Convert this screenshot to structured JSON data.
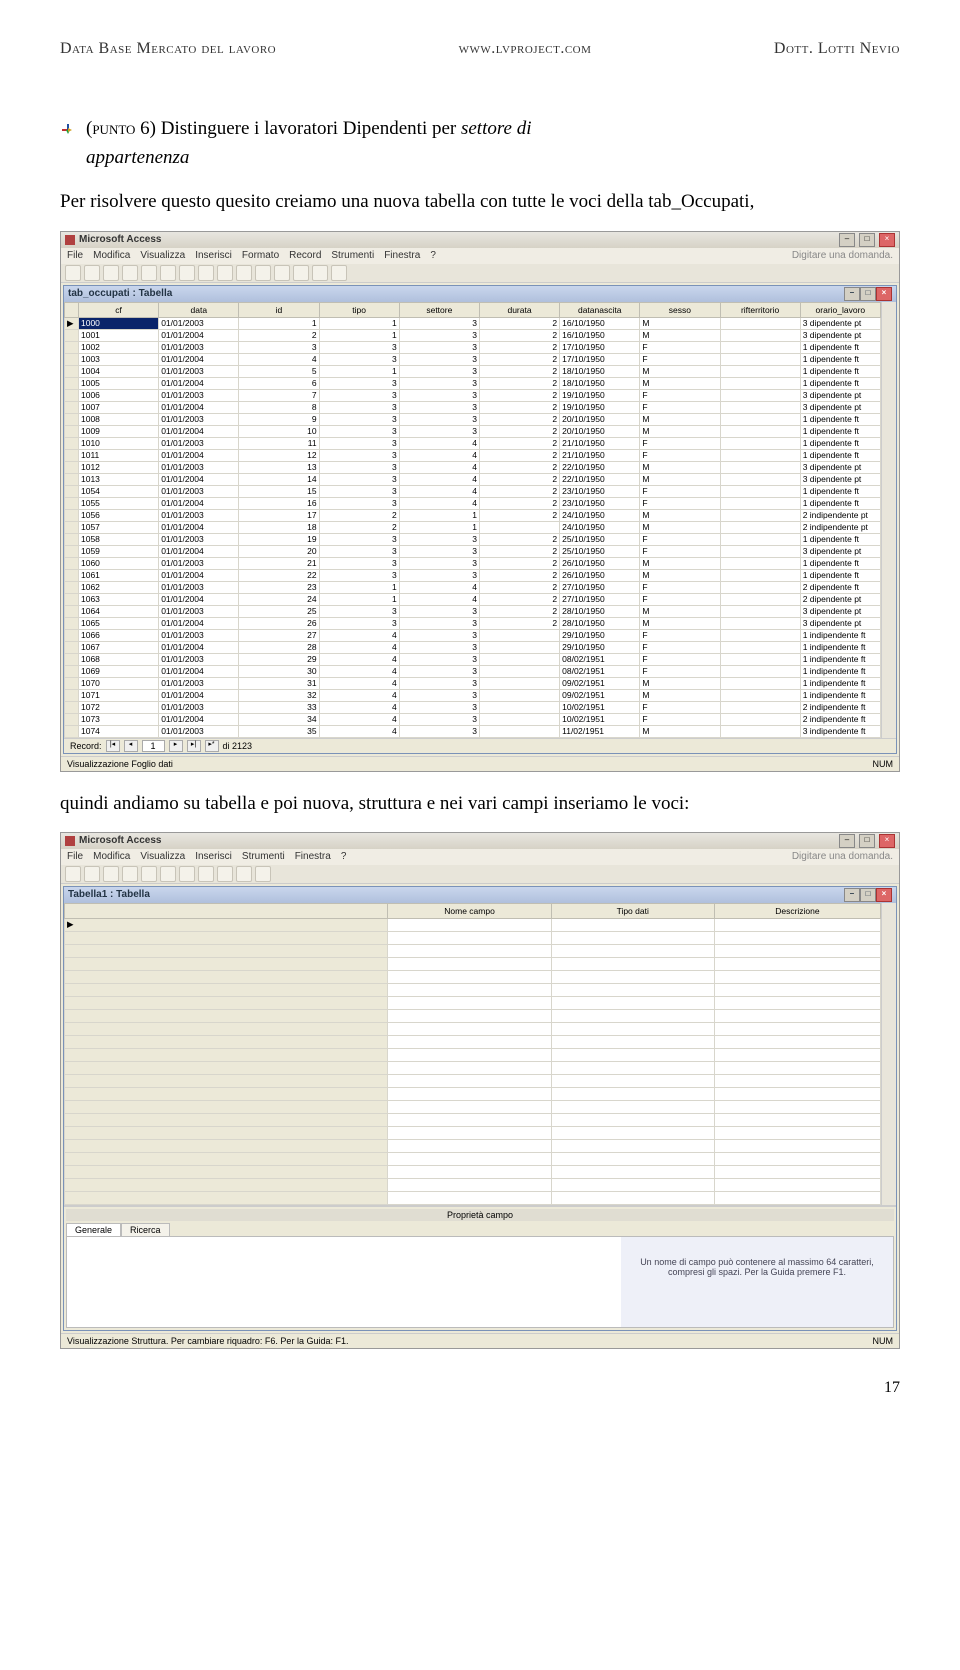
{
  "header": {
    "left": "Data Base Mercato del lavoro",
    "center": "www.lvproject.com",
    "right": "Dott. Lotti Nevio"
  },
  "intro": {
    "punto_label": "(punto 6)",
    "line1_a": " Distinguere i lavoratori Dipendenti per ",
    "line1_b": "settore di",
    "line2": "appartenenza"
  },
  "para1": "Per risolvere questo quesito creiamo una nuova tabella con tutte le voci della tab_Occupati,",
  "shot1": {
    "app_title": "Microsoft Access",
    "menu": [
      "File",
      "Modifica",
      "Visualizza",
      "Inserisci",
      "Formato",
      "Record",
      "Strumenti",
      "Finestra",
      "?"
    ],
    "search_hint": "Digitare una domanda.",
    "sub_title": "tab_occupati : Tabella",
    "cols": [
      "cf",
      "data",
      "id",
      "tipo",
      "settore",
      "durata",
      "datanascita",
      "sesso",
      "rifterritorio",
      "orario_lavoro"
    ],
    "rows": [
      [
        "1000",
        "01/01/2003",
        "1",
        "1",
        "3",
        "2",
        "16/10/1950",
        "M",
        "",
        "3 dipendente pt"
      ],
      [
        "1001",
        "01/01/2004",
        "2",
        "1",
        "3",
        "2",
        "16/10/1950",
        "M",
        "",
        "3 dipendente pt"
      ],
      [
        "1002",
        "01/01/2003",
        "3",
        "3",
        "3",
        "2",
        "17/10/1950",
        "F",
        "",
        "1 dipendente ft"
      ],
      [
        "1003",
        "01/01/2004",
        "4",
        "3",
        "3",
        "2",
        "17/10/1950",
        "F",
        "",
        "1 dipendente ft"
      ],
      [
        "1004",
        "01/01/2003",
        "5",
        "1",
        "3",
        "2",
        "18/10/1950",
        "M",
        "",
        "1 dipendente ft"
      ],
      [
        "1005",
        "01/01/2004",
        "6",
        "3",
        "3",
        "2",
        "18/10/1950",
        "M",
        "",
        "1 dipendente ft"
      ],
      [
        "1006",
        "01/01/2003",
        "7",
        "3",
        "3",
        "2",
        "19/10/1950",
        "F",
        "",
        "3 dipendente pt"
      ],
      [
        "1007",
        "01/01/2004",
        "8",
        "3",
        "3",
        "2",
        "19/10/1950",
        "F",
        "",
        "3 dipendente pt"
      ],
      [
        "1008",
        "01/01/2003",
        "9",
        "3",
        "3",
        "2",
        "20/10/1950",
        "M",
        "",
        "1 dipendente ft"
      ],
      [
        "1009",
        "01/01/2004",
        "10",
        "3",
        "3",
        "2",
        "20/10/1950",
        "M",
        "",
        "1 dipendente ft"
      ],
      [
        "1010",
        "01/01/2003",
        "11",
        "3",
        "4",
        "2",
        "21/10/1950",
        "F",
        "",
        "1 dipendente ft"
      ],
      [
        "1011",
        "01/01/2004",
        "12",
        "3",
        "4",
        "2",
        "21/10/1950",
        "F",
        "",
        "1 dipendente ft"
      ],
      [
        "1012",
        "01/01/2003",
        "13",
        "3",
        "4",
        "2",
        "22/10/1950",
        "M",
        "",
        "3 dipendente pt"
      ],
      [
        "1013",
        "01/01/2004",
        "14",
        "3",
        "4",
        "2",
        "22/10/1950",
        "M",
        "",
        "3 dipendente pt"
      ],
      [
        "1054",
        "01/01/2003",
        "15",
        "3",
        "4",
        "2",
        "23/10/1950",
        "F",
        "",
        "1 dipendente ft"
      ],
      [
        "1055",
        "01/01/2004",
        "16",
        "3",
        "4",
        "2",
        "23/10/1950",
        "F",
        "",
        "1 dipendente ft"
      ],
      [
        "1056",
        "01/01/2003",
        "17",
        "2",
        "1",
        "2",
        "24/10/1950",
        "M",
        "",
        "2 indipendente pt"
      ],
      [
        "1057",
        "01/01/2004",
        "18",
        "2",
        "1",
        "",
        "24/10/1950",
        "M",
        "",
        "2 indipendente pt"
      ],
      [
        "1058",
        "01/01/2003",
        "19",
        "3",
        "3",
        "2",
        "25/10/1950",
        "F",
        "",
        "1 dipendente ft"
      ],
      [
        "1059",
        "01/01/2004",
        "20",
        "3",
        "3",
        "2",
        "25/10/1950",
        "F",
        "",
        "3 dipendente pt"
      ],
      [
        "1060",
        "01/01/2003",
        "21",
        "3",
        "3",
        "2",
        "26/10/1950",
        "M",
        "",
        "1 dipendente ft"
      ],
      [
        "1061",
        "01/01/2004",
        "22",
        "3",
        "3",
        "2",
        "26/10/1950",
        "M",
        "",
        "1 dipendente ft"
      ],
      [
        "1062",
        "01/01/2003",
        "23",
        "1",
        "4",
        "2",
        "27/10/1950",
        "F",
        "",
        "2 dipendente ft"
      ],
      [
        "1063",
        "01/01/2004",
        "24",
        "1",
        "4",
        "2",
        "27/10/1950",
        "F",
        "",
        "2 dipendente pt"
      ],
      [
        "1064",
        "01/01/2003",
        "25",
        "3",
        "3",
        "2",
        "28/10/1950",
        "M",
        "",
        "3 dipendente pt"
      ],
      [
        "1065",
        "01/01/2004",
        "26",
        "3",
        "3",
        "2",
        "28/10/1950",
        "M",
        "",
        "3 dipendente pt"
      ],
      [
        "1066",
        "01/01/2003",
        "27",
        "4",
        "3",
        "",
        "29/10/1950",
        "F",
        "",
        "1 indipendente ft"
      ],
      [
        "1067",
        "01/01/2004",
        "28",
        "4",
        "3",
        "",
        "29/10/1950",
        "F",
        "",
        "1 indipendente ft"
      ],
      [
        "1068",
        "01/01/2003",
        "29",
        "4",
        "3",
        "",
        "08/02/1951",
        "F",
        "",
        "1 indipendente ft"
      ],
      [
        "1069",
        "01/01/2004",
        "30",
        "4",
        "3",
        "",
        "08/02/1951",
        "F",
        "",
        "1 indipendente ft"
      ],
      [
        "1070",
        "01/01/2003",
        "31",
        "4",
        "3",
        "",
        "09/02/1951",
        "M",
        "",
        "1 indipendente ft"
      ],
      [
        "1071",
        "01/01/2004",
        "32",
        "4",
        "3",
        "",
        "09/02/1951",
        "M",
        "",
        "1 indipendente ft"
      ],
      [
        "1072",
        "01/01/2003",
        "33",
        "4",
        "3",
        "",
        "10/02/1951",
        "F",
        "",
        "2 indipendente ft"
      ],
      [
        "1073",
        "01/01/2004",
        "34",
        "4",
        "3",
        "",
        "10/02/1951",
        "F",
        "",
        "2 indipendente ft"
      ],
      [
        "1074",
        "01/01/2003",
        "35",
        "4",
        "3",
        "",
        "11/02/1951",
        "M",
        "",
        "3 indipendente ft"
      ]
    ],
    "record_label": "Record:",
    "record_pos": "1",
    "record_total": "di 2123",
    "status": "Visualizzazione Foglio dati",
    "num": "NUM"
  },
  "para2": "quindi andiamo su tabella e poi nuova, struttura e nei vari campi inseriamo le voci:",
  "shot2": {
    "app_title": "Microsoft Access",
    "menu": [
      "File",
      "Modifica",
      "Visualizza",
      "Inserisci",
      "Strumenti",
      "Finestra",
      "?"
    ],
    "search_hint": "Digitare una domanda.",
    "sub_title": "Tabella1 : Tabella",
    "cols": [
      "Nome campo",
      "Tipo dati",
      "Descrizione"
    ],
    "prop_title": "Proprietà campo",
    "tab_generale": "Generale",
    "tab_ricerca": "Ricerca",
    "hint": "Un nome di campo può contenere al massimo 64 caratteri, compresi gli spazi. Per la Guida premere F1.",
    "status": "Visualizzazione Struttura. Per cambiare riquadro: F6. Per la Guida: F1.",
    "num": "NUM"
  },
  "pagenum": "17"
}
